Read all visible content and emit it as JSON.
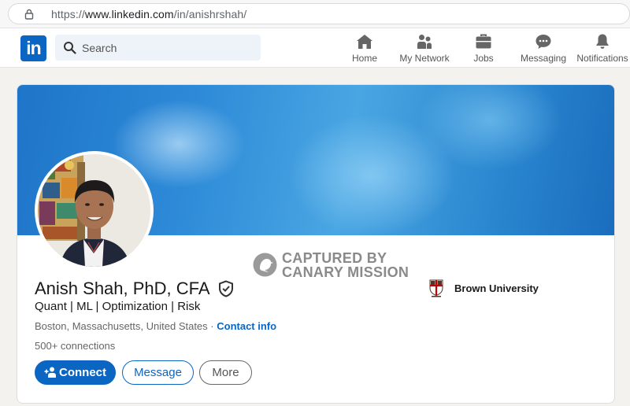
{
  "browser": {
    "url_scheme": "https://",
    "url_host": "www.linkedin.com",
    "url_path": "/in/anishrshah/"
  },
  "nav": {
    "logo": "in",
    "search_placeholder": "Search",
    "items": [
      {
        "label": "Home",
        "icon": "home-icon"
      },
      {
        "label": "My Network",
        "icon": "network-icon"
      },
      {
        "label": "Jobs",
        "icon": "briefcase-icon"
      },
      {
        "label": "Messaging",
        "icon": "chat-icon"
      },
      {
        "label": "Notifications",
        "icon": "bell-icon"
      }
    ]
  },
  "watermark": {
    "line1": "CAPTURED BY",
    "line2": "CANARY MISSION"
  },
  "profile": {
    "name": "Anish Shah, PhD, CFA",
    "headline": "Quant | ML | Optimization | Risk",
    "location": "Boston, Massachusetts, United States",
    "separator": " · ",
    "contact_label": "Contact info",
    "connections": "500+ connections",
    "school": "Brown University"
  },
  "actions": {
    "connect": "Connect",
    "message": "Message",
    "more": "More"
  },
  "colors": {
    "brand": "#0a66c2",
    "page_bg": "#f4f2ee"
  }
}
